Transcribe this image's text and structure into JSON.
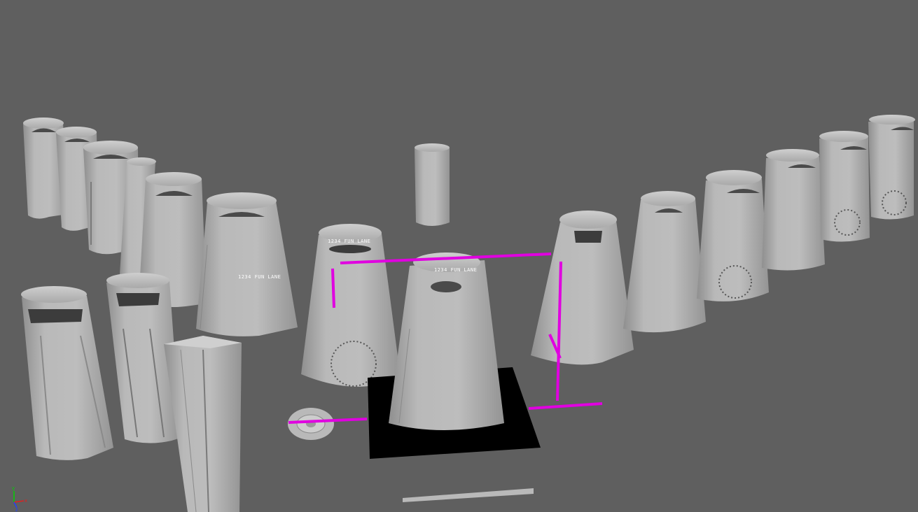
{
  "viewport": {
    "background": "#5f5f5f",
    "selection_color": "#e000e0",
    "object_color": "#b4b4b4",
    "ground_plane_color": "#000000"
  },
  "engraving": {
    "text": "1234 FUN LANE"
  },
  "axis_gizmo": {
    "y_label": "y",
    "x_label": "x",
    "z_label": "z",
    "y_color": "#00d000",
    "x_color": "#e02020",
    "z_color": "#2040ff"
  }
}
